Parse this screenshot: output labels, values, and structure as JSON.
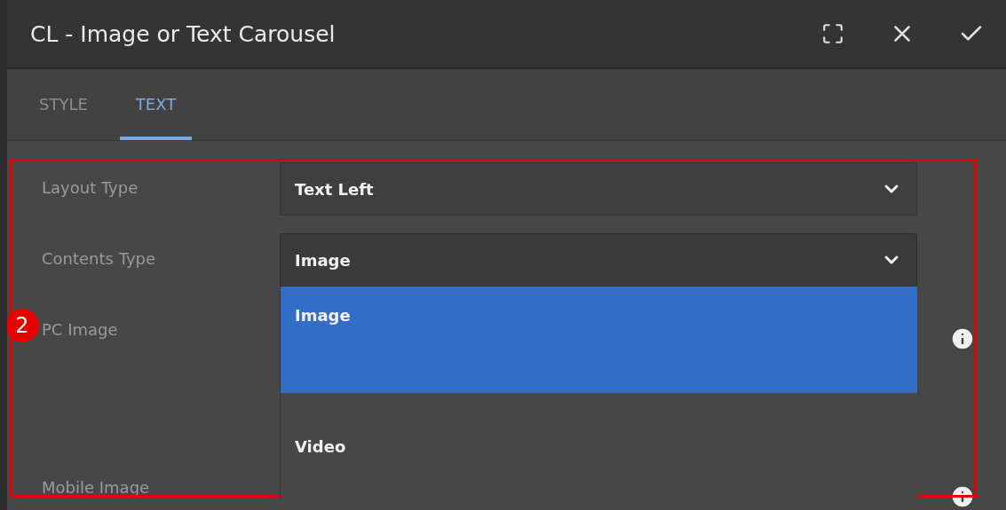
{
  "window": {
    "title": "CL - Image or Text Carousel"
  },
  "tabs": [
    {
      "label": "STYLE",
      "selected": false
    },
    {
      "label": "TEXT",
      "selected": true
    }
  ],
  "annotation": {
    "number": "2"
  },
  "fields": [
    {
      "kind": "select",
      "label": "Layout Type",
      "value": "Text Left"
    },
    {
      "kind": "select",
      "label": "Contents Type",
      "value": "Image",
      "expanded": true,
      "options": [
        {
          "label": "Image",
          "selected": true
        },
        {
          "label": "Video",
          "selected": false
        }
      ]
    },
    {
      "kind": "image",
      "label": "PC Image"
    },
    {
      "kind": "image",
      "label": "Mobile Image"
    }
  ]
}
